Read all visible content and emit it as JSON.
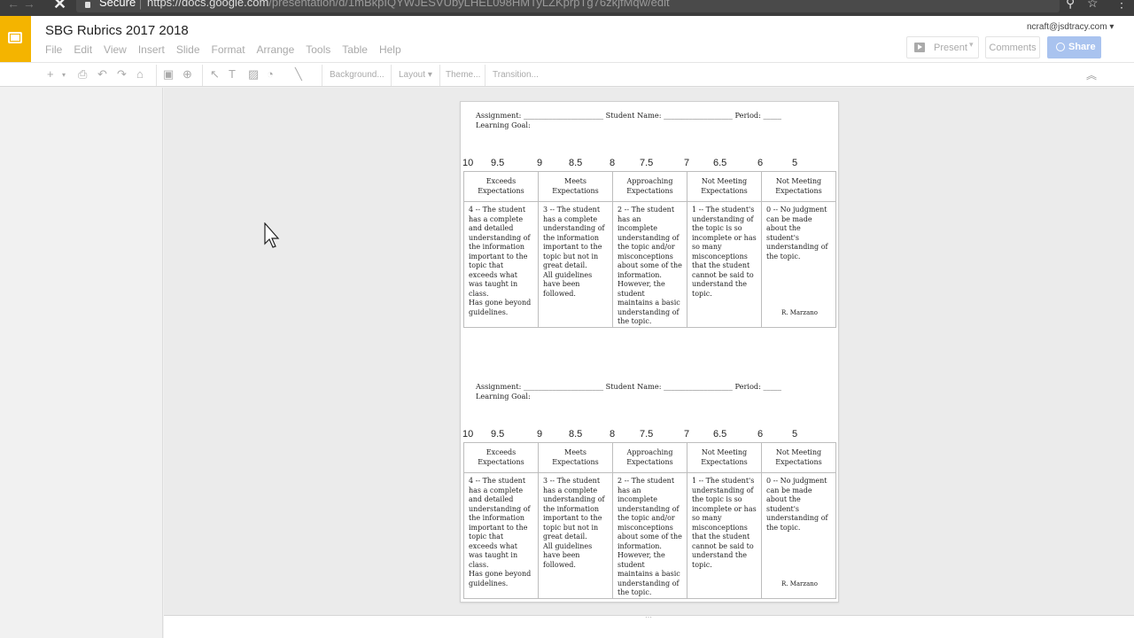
{
  "browser": {
    "secure_label": "Secure",
    "url_host": "https://docs.google.com",
    "url_path": "/presentation/d/1mBkpIQYWJESVUbyLHEL098HMTyLZKprpTg76zkjfMqw/edit"
  },
  "app": {
    "doc_title": "SBG Rubrics 2017 2018",
    "account": "ncraft@jsdtracy.com",
    "menu": [
      "File",
      "Edit",
      "View",
      "Insert",
      "Slide",
      "Format",
      "Arrange",
      "Tools",
      "Table",
      "Help"
    ],
    "present_label": "Present",
    "comments_label": "Comments",
    "share_label": "Share"
  },
  "toolbar": {
    "background_label": "Background...",
    "layout_label": "Layout",
    "theme_label": "Theme...",
    "transition_label": "Transition..."
  },
  "rubric": {
    "header_line": "Assignment: ______________________ Student Name: ___________________   Period: _____",
    "learning_goal": "Learning Goal:",
    "scores": [
      "10",
      "9.5",
      "9",
      "8.5",
      "8",
      "7.5",
      "7",
      "6.5",
      "6",
      "5"
    ],
    "columns": [
      {
        "title": "Exceeds\nExpectations",
        "body": "4 -- The student has a complete and detailed understanding of the information important to the topic that exceeds what was taught in class.\nHas gone beyond guidelines."
      },
      {
        "title": "Meets\nExpectations",
        "body": "3 -- The student has a complete understanding of the information important to the topic but not in great detail.\nAll guidelines have been followed."
      },
      {
        "title": "Approaching\nExpectations",
        "body": "2 -- The student has an incomplete understanding of the topic and/or misconceptions about some of the information. However, the student maintains a basic understanding of the topic."
      },
      {
        "title": "Not Meeting\nExpectations",
        "body": "1 -- The student's understanding of the topic is so incomplete or has so many misconceptions that the student cannot be said to understand the topic."
      },
      {
        "title": "Not Meeting\nExpectations",
        "body": "0 -- No judgment can be made about the student's understanding of the topic."
      }
    ],
    "attribution": "R. Marzano"
  }
}
